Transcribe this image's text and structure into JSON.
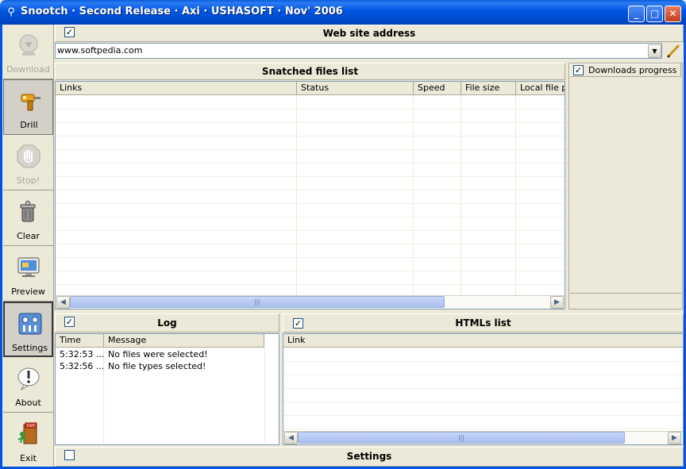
{
  "window": {
    "title": "Snootch · Second Release · Axi · USHASOFT · Nov' 2006",
    "minimize": "_",
    "maximize": "□",
    "close": "✕"
  },
  "toolbar": {
    "download": "Download",
    "drill": "Drill",
    "stop": "Stop!",
    "clear": "Clear",
    "preview": "Preview",
    "settings": "Settings",
    "about": "About",
    "exit": "Exit"
  },
  "address": {
    "header": "Web site address",
    "checked": "✓",
    "value": "www.softpedia.com"
  },
  "snatched": {
    "header": "Snatched files list",
    "columns": [
      "Links",
      "Status",
      "Speed",
      "File size",
      "Local file pa"
    ]
  },
  "downloads": {
    "label": "Downloads progress",
    "checked": "✓"
  },
  "log": {
    "header": "Log",
    "checked": "✓",
    "columns": [
      "Time",
      "Message"
    ],
    "rows": [
      {
        "time": "5:32:53 ...",
        "message": "No files were selected!"
      },
      {
        "time": "5:32:56 ...",
        "message": "No file types selected!"
      }
    ]
  },
  "htmls": {
    "header": "HTMLs list",
    "checked": "✓",
    "columns": [
      "Link"
    ]
  },
  "settings_bar": {
    "header": "Settings",
    "checked": ""
  },
  "colors": {
    "titlebar": "#0054e3",
    "panel": "#ece9d8",
    "grid": "#ebeadb"
  }
}
